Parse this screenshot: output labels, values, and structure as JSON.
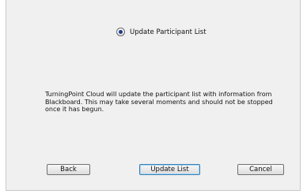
{
  "options": {
    "update_participant_list": {
      "label": "Update Participant List",
      "selected": true
    }
  },
  "message": {
    "text": "TurningPoint Cloud will update the participant list with information from Blackboard. This may take several moments and should not be stopped once it has begun."
  },
  "buttons": {
    "back": "Back",
    "update_list": "Update List",
    "cancel": "Cancel"
  },
  "colors": {
    "panel_background": "#f0f0f0",
    "focus_border": "#3c7fb1",
    "radio_dot": "#1f3a8c"
  }
}
